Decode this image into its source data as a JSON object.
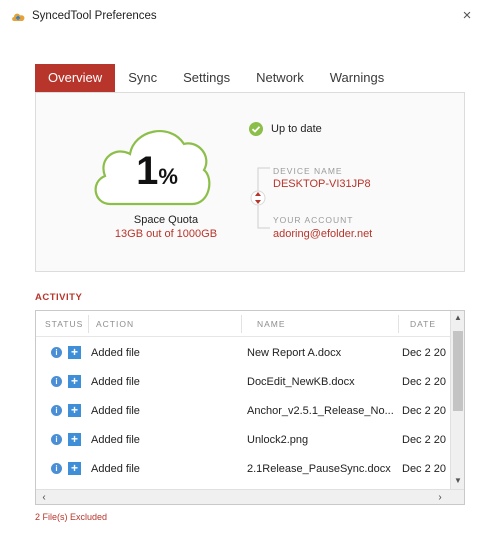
{
  "window": {
    "title": "SyncedTool Preferences",
    "close_glyph": "×"
  },
  "tabs": [
    {
      "label": "Overview",
      "active": true
    },
    {
      "label": "Sync",
      "active": false
    },
    {
      "label": "Settings",
      "active": false
    },
    {
      "label": "Network",
      "active": false
    },
    {
      "label": "Warnings",
      "active": false
    }
  ],
  "overview": {
    "quota_percent": "1",
    "quota_percent_sign": "%",
    "quota_label": "Space Quota",
    "quota_value": "13GB out of 1000GB",
    "status_text": "Up to date",
    "device_label": "DEVICE NAME",
    "device_name": "DESKTOP-VI31JP8",
    "account_label": "YOUR ACCOUNT",
    "account_value": "adoring@efolder.net"
  },
  "activity": {
    "heading": "ACTIVITY",
    "columns": {
      "status": "STATUS",
      "action": "ACTION",
      "name": "NAME",
      "date": "DATE"
    },
    "rows": [
      {
        "action": "Added file",
        "name": "New Report A.docx",
        "date": "Dec 2 20"
      },
      {
        "action": "Added file",
        "name": "DocEdit_NewKB.docx",
        "date": "Dec 2 20"
      },
      {
        "action": "Added file",
        "name": "Anchor_v2.5.1_Release_No...",
        "date": "Dec 2 20"
      },
      {
        "action": "Added file",
        "name": "Unlock2.png",
        "date": "Dec 2 20"
      },
      {
        "action": "Added file",
        "name": "2.1Release_PauseSync.docx",
        "date": "Dec 2 20"
      }
    ],
    "excluded_text": "2 File(s) Excluded"
  },
  "colors": {
    "accent": "#b8352b",
    "status_ok": "#8cbf4a",
    "info_blue": "#4a8fd6"
  },
  "icons": {
    "app": "synced-tool-logo-icon",
    "status": "check-circle-icon",
    "info": "info-circle-icon",
    "action": "add-file-plus-icon",
    "connector": "sync-arrows-icon"
  }
}
